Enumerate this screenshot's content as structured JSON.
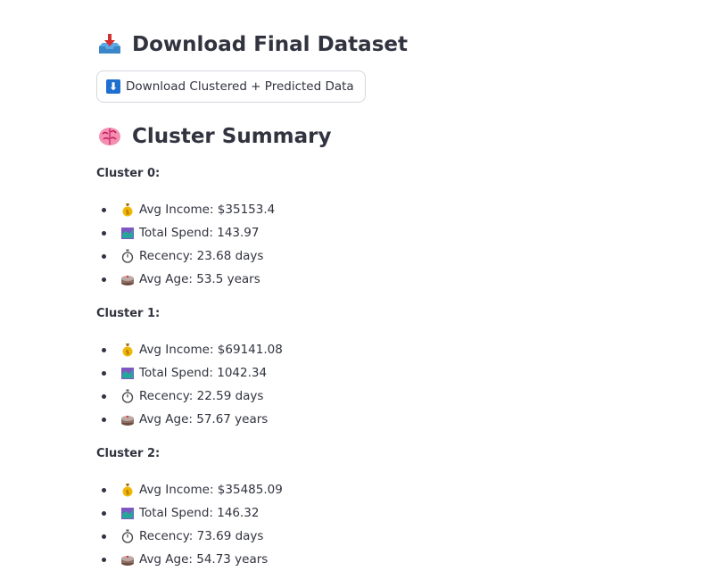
{
  "download_section": {
    "icon": "inbox-tray-icon",
    "title": "Download Final Dataset",
    "button": {
      "icon": "down-arrow-icon",
      "icon_glyph": "⬇",
      "label": "Download Clustered + Predicted Data"
    }
  },
  "summary_section": {
    "icon": "brain-icon",
    "title": "Cluster Summary",
    "clusters": [
      {
        "heading": "Cluster 0:",
        "items": [
          {
            "icon": "money-bag-icon",
            "text": "Avg Income: $35153.4"
          },
          {
            "icon": "shopping-chart-icon",
            "text": "Total Spend: 143.97"
          },
          {
            "icon": "stopwatch-icon",
            "text": "Recency: 23.68 days"
          },
          {
            "icon": "cake-icon",
            "text": "Avg Age: 53.5 years"
          }
        ]
      },
      {
        "heading": "Cluster 1:",
        "items": [
          {
            "icon": "money-bag-icon",
            "text": "Avg Income: $69141.08"
          },
          {
            "icon": "shopping-chart-icon",
            "text": "Total Spend: 1042.34"
          },
          {
            "icon": "stopwatch-icon",
            "text": "Recency: 22.59 days"
          },
          {
            "icon": "cake-icon",
            "text": "Avg Age: 57.67 years"
          }
        ]
      },
      {
        "heading": "Cluster 2:",
        "items": [
          {
            "icon": "money-bag-icon",
            "text": "Avg Income: $35485.09"
          },
          {
            "icon": "shopping-chart-icon",
            "text": "Total Spend: 146.32"
          },
          {
            "icon": "stopwatch-icon",
            "text": "Recency: 73.69 days"
          },
          {
            "icon": "cake-icon",
            "text": "Avg Age: 54.73 years"
          }
        ]
      }
    ]
  },
  "colors": {
    "text": "#31333f",
    "button_border": "#d5d7dc",
    "button_icon_bg": "#1f6fd1"
  }
}
